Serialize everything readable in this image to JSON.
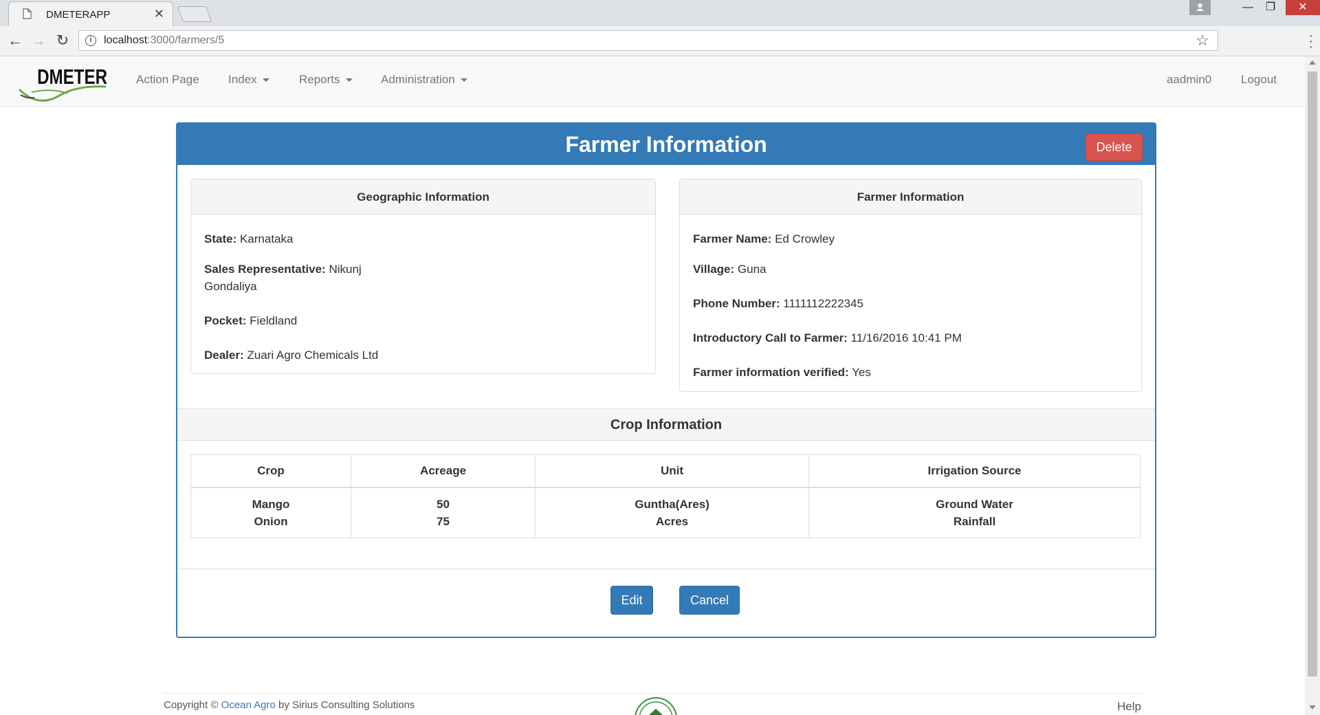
{
  "browser": {
    "tab_title": "DMETERAPP",
    "url_host": "localhost",
    "url_path": ":3000/farmers/5"
  },
  "navbar": {
    "logo_text": "DMETER",
    "links": [
      "Action Page",
      "Index",
      "Reports",
      "Administration"
    ],
    "user": "aadmin0",
    "logout": "Logout"
  },
  "panel": {
    "title": "Farmer Information",
    "delete_label": "Delete"
  },
  "geographic": {
    "heading": "Geographic Information",
    "state_label": "State:",
    "state": "Karnataka",
    "sales_rep_label": "Sales Representative:",
    "sales_rep_line1": "Nikunj",
    "sales_rep_line2": "Gondaliya",
    "pocket_label": "Pocket:",
    "pocket": "Fieldland",
    "dealer_label": "Dealer:",
    "dealer": "Zuari Agro Chemicals Ltd"
  },
  "farmer": {
    "heading": "Farmer Information",
    "name_label": "Farmer Name:",
    "name": "Ed Crowley",
    "village_label": "Village:",
    "village": "Guna",
    "phone_label": "Phone Number:",
    "phone": "1111112222345",
    "intro_label": "Introductory Call to Farmer:",
    "intro": "11/16/2016 10:41 PM",
    "verified_label": "Farmer information verified:",
    "verified": "Yes"
  },
  "crops": {
    "heading": "Crop Information",
    "columns": [
      "Crop",
      "Acreage",
      "Unit",
      "Irrigation Source"
    ],
    "rows": [
      [
        "Mango",
        "50",
        "Guntha(Ares)",
        "Ground Water"
      ],
      [
        "Onion",
        "75",
        "Acres",
        "Rainfall"
      ]
    ]
  },
  "actions": {
    "edit_label": "Edit",
    "cancel_label": "Cancel"
  },
  "footer": {
    "copyright_prefix": "Copyright ©",
    "company": "Ocean Agro",
    "copyright_suffix": "by Sirius Consulting Solutions",
    "help": "Help"
  }
}
